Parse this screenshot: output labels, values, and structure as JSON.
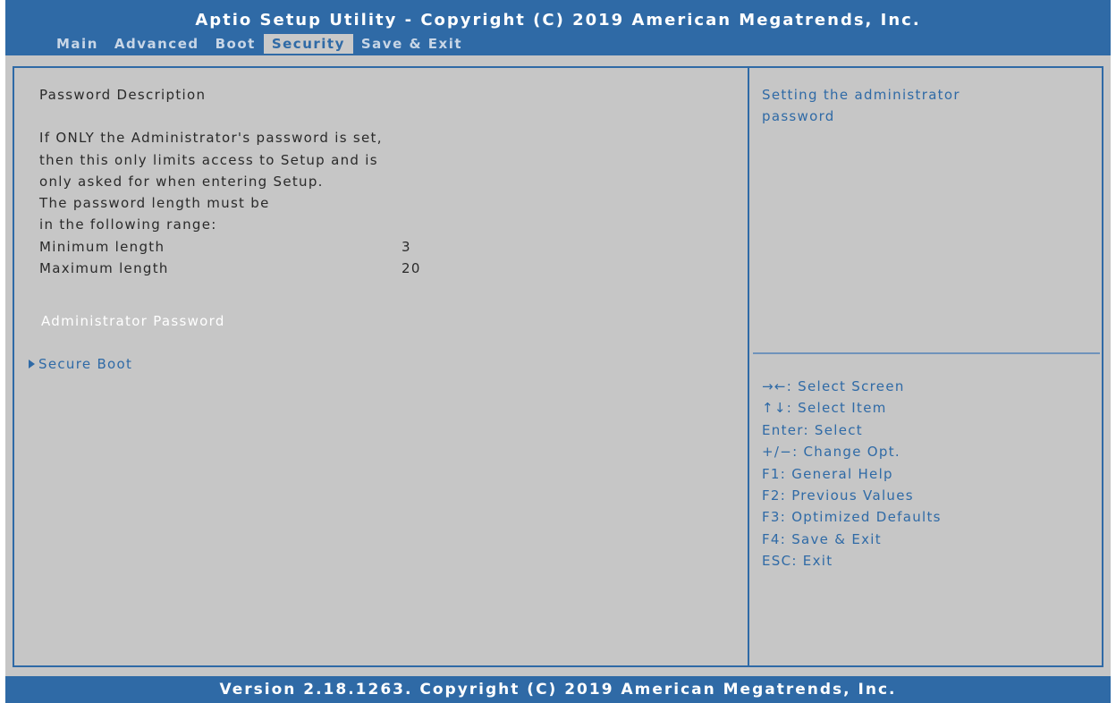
{
  "header": {
    "title": "Aptio Setup Utility - Copyright (C) 2019 American Megatrends, Inc.",
    "tabs": [
      {
        "label": "Main"
      },
      {
        "label": "Advanced"
      },
      {
        "label": "Boot"
      },
      {
        "label": "Security",
        "active": true
      },
      {
        "label": "Save & Exit"
      }
    ]
  },
  "main": {
    "section_title": "Password Description",
    "description": [
      "If ONLY the Administrator's password is set,",
      "then this only limits access to Setup and is",
      "only asked for when entering Setup.",
      "The password length must be",
      "in the following range:"
    ],
    "min_length": {
      "label": "Minimum length",
      "value": "3"
    },
    "max_length": {
      "label": "Maximum length",
      "value": "20"
    },
    "admin_password_label": "Administrator Password",
    "secure_boot_label": "Secure Boot"
  },
  "help": {
    "text": [
      "Setting the administrator",
      "password"
    ],
    "keys": [
      "→←: Select Screen",
      "↑↓: Select Item",
      "Enter: Select",
      "+/−: Change Opt.",
      "F1: General Help",
      "F2: Previous Values",
      "F3: Optimized Defaults",
      "F4: Save & Exit",
      "ESC: Exit"
    ]
  },
  "footer": {
    "version": "Version 2.18.1263. Copyright (C) 2019 American Megatrends, Inc."
  },
  "colors": {
    "header_blue": "#2f6aa6",
    "panel_gray": "#c6c6c6",
    "text_dark": "#2a2a2a",
    "highlight_white": "#ffffff"
  }
}
